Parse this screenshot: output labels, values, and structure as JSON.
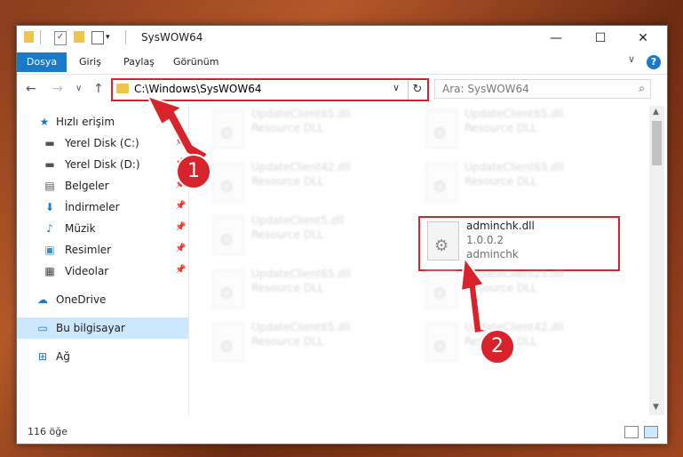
{
  "window": {
    "title": "SysWOW64",
    "minimize": "—",
    "maximize": "☐",
    "close": "✕"
  },
  "ribbon": {
    "file_tab": "Dosya",
    "tabs": [
      "Giriş",
      "Paylaş",
      "Görünüm"
    ],
    "help": "?",
    "expand": "∨"
  },
  "nav": {
    "back": "←",
    "forward": "→",
    "recent": "∨",
    "up": "↑"
  },
  "address": {
    "path": "C:\\Windows\\SysWOW64",
    "dropdown": "∨",
    "refresh": "↻"
  },
  "search": {
    "placeholder": "Ara: SysWOW64",
    "icon": "⌕"
  },
  "sidebar": {
    "quick_access": "Hızlı erişim",
    "items": [
      {
        "label": "Yerel Disk (C:)",
        "icon": "drive-icon"
      },
      {
        "label": "Yerel Disk (D:)",
        "icon": "drive-icon"
      },
      {
        "label": "Belgeler",
        "icon": "documents-icon"
      },
      {
        "label": "İndirmeler",
        "icon": "downloads-icon"
      },
      {
        "label": "Müzik",
        "icon": "music-icon"
      },
      {
        "label": "Resimler",
        "icon": "pictures-icon"
      },
      {
        "label": "Videolar",
        "icon": "videos-icon"
      }
    ],
    "onedrive": "OneDrive",
    "this_pc": "Bu bilgisayar",
    "network": "Ağ"
  },
  "files": [
    {
      "name": "UpdateClient65.dll",
      "type": "Resource DLL"
    },
    {
      "name": "UpdateClient65.dll",
      "type": "Resource DLL"
    },
    {
      "name": "UpdateClient42.dll",
      "type": "Resource DLL"
    },
    {
      "name": "UpdateClient65.dll",
      "type": "Resource DLL"
    },
    {
      "name": "UpdateClient5.dll",
      "type": "Resource DLL"
    },
    {
      "name": "UpdateClient65.dll",
      "type": "Resource DLL"
    },
    {
      "name": "UpdateClient21.dll",
      "type": "Resource DLL"
    },
    {
      "name": "UpdateClient65.dll",
      "type": "Resource DLL"
    },
    {
      "name": "UpdateClient42.dll",
      "type": "Resource DLL"
    }
  ],
  "highlighted_file": {
    "name": "adminchk.dll",
    "version": "1.0.0.2",
    "description": "adminchk"
  },
  "status": {
    "count": "116 öğe"
  },
  "callouts": [
    "1",
    "2"
  ],
  "colors": {
    "accent": "#1979ca",
    "highlight": "#d9232c",
    "selection": "#cce8ff"
  }
}
